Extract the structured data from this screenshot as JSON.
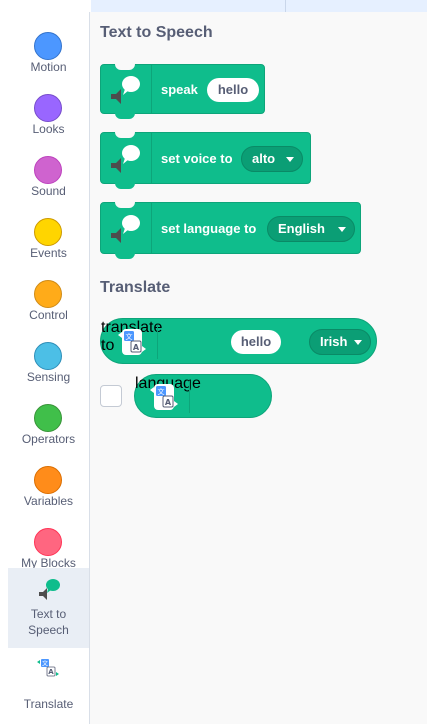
{
  "categories": [
    {
      "key": "motion",
      "label": "Motion",
      "color": "#4c97ff"
    },
    {
      "key": "looks",
      "label": "Looks",
      "color": "#9966ff"
    },
    {
      "key": "sound",
      "label": "Sound",
      "color": "#cf63cf"
    },
    {
      "key": "events",
      "label": "Events",
      "color": "#ffd500"
    },
    {
      "key": "control",
      "label": "Control",
      "color": "#ffab19"
    },
    {
      "key": "sensing",
      "label": "Sensing",
      "color": "#4cbfe6"
    },
    {
      "key": "operators",
      "label": "Operators",
      "color": "#40bf4a"
    },
    {
      "key": "variables",
      "label": "Variables",
      "color": "#ff8c1a"
    },
    {
      "key": "my-blocks",
      "label": "My Blocks",
      "color": "#ff6680"
    }
  ],
  "extensions": {
    "tts": {
      "line1": "Text to",
      "line2": "Speech",
      "icon": "speech-bubble-speaker-icon",
      "selected": true
    },
    "translate": {
      "label": "Translate",
      "icon": "translate-icon"
    }
  },
  "palette": {
    "tts_section": {
      "title": "Text to Speech",
      "speak": {
        "label": "speak",
        "input": "hello"
      },
      "set_voice": {
        "label": "set voice to",
        "value": "alto"
      },
      "set_language": {
        "label": "set language to",
        "value": "English"
      }
    },
    "translate_section": {
      "title": "Translate",
      "translate": {
        "label": "translate",
        "input": "hello",
        "connector": "to",
        "value": "Irish"
      },
      "language": {
        "label": "language"
      }
    }
  },
  "colors": {
    "extension_green": "#0fbd8c",
    "extension_green_dark": "#0da57a",
    "text_gray": "#575e75",
    "selected_bg": "#e9eef5"
  }
}
